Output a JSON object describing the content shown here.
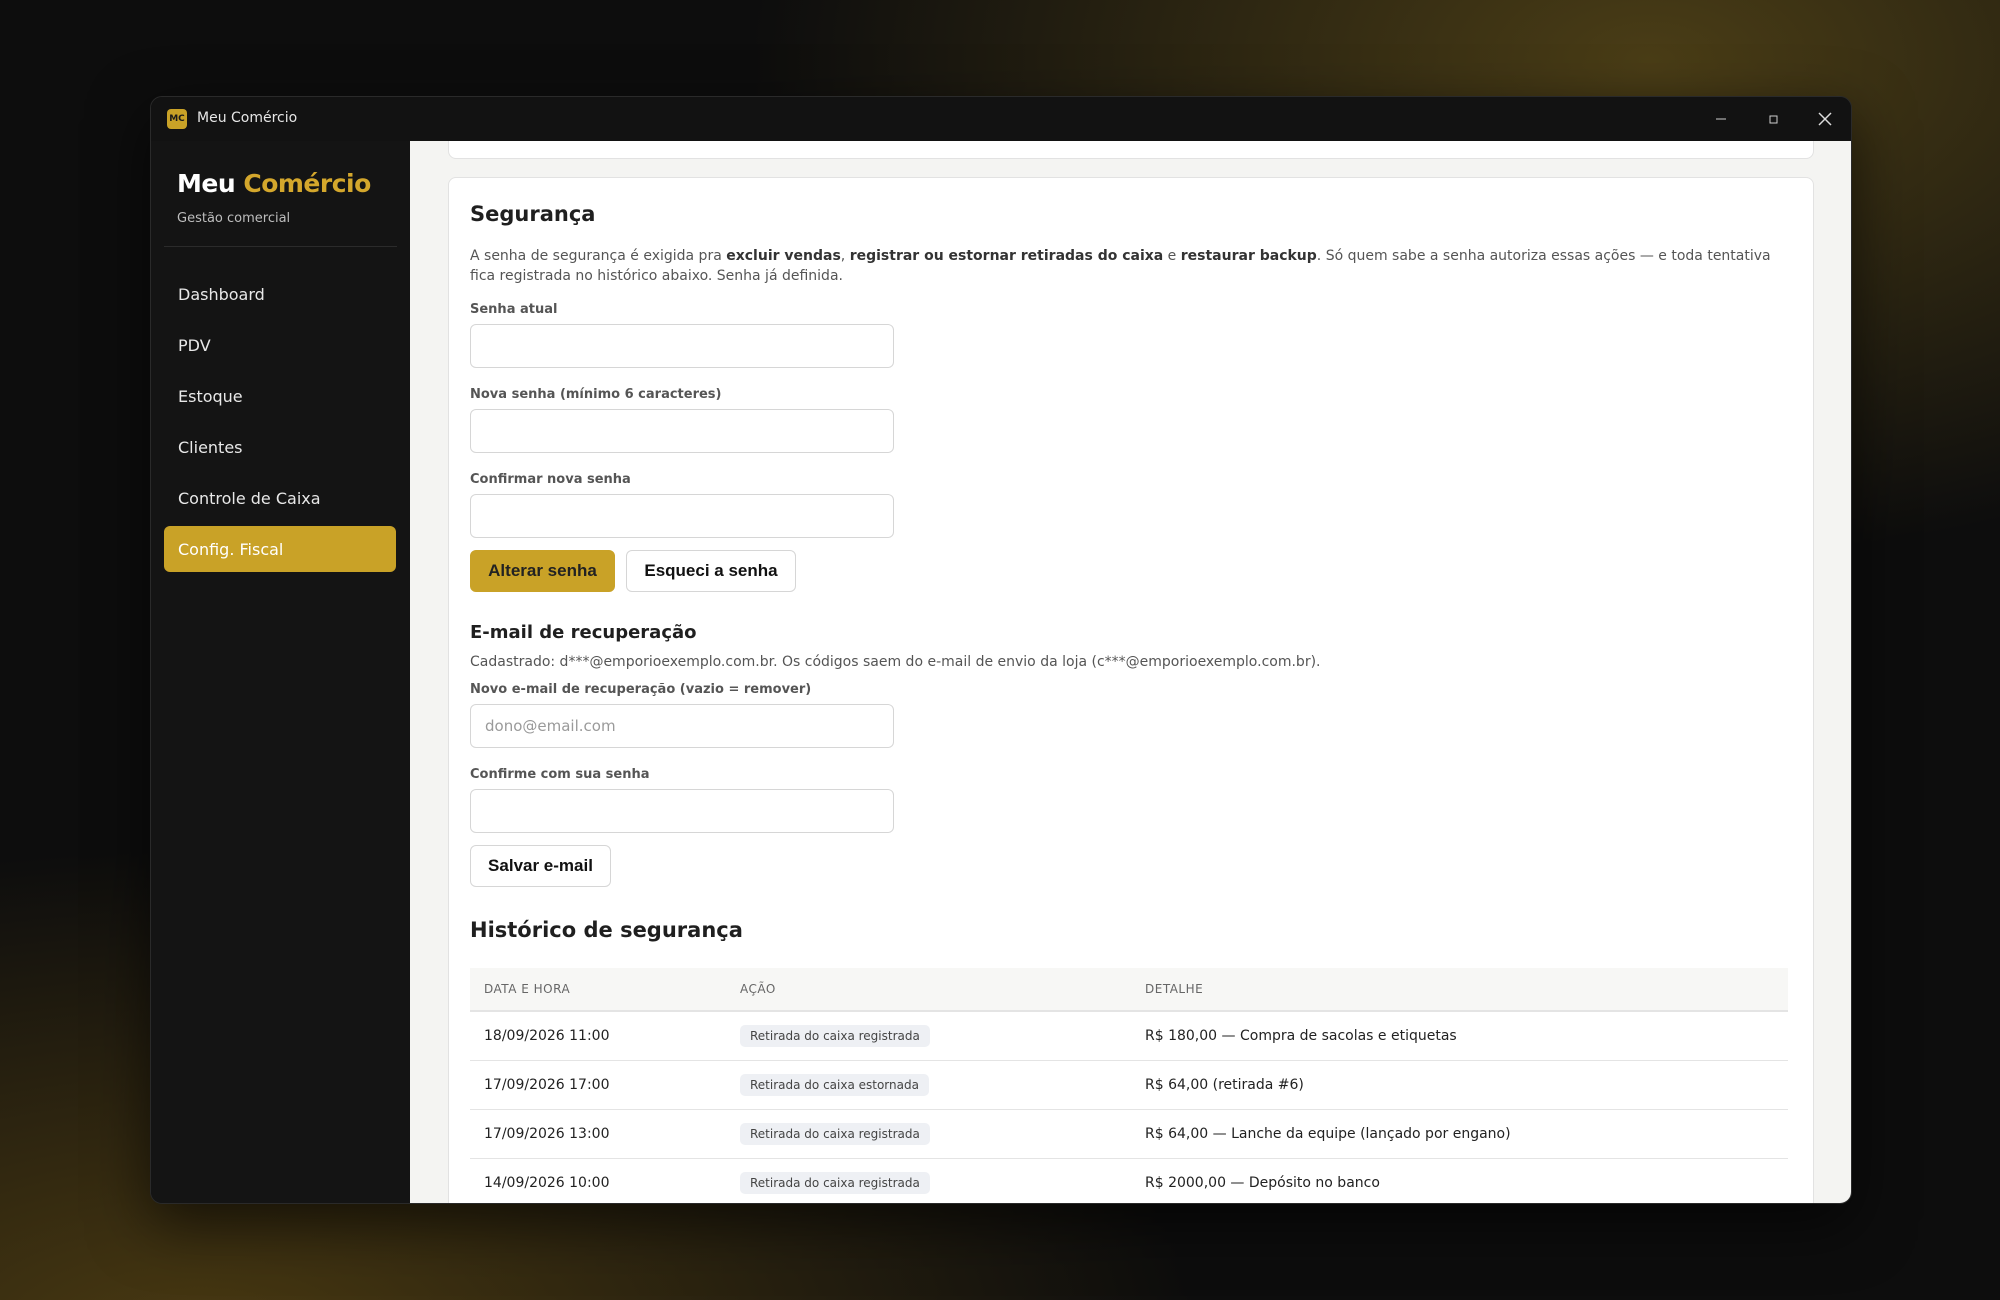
{
  "window": {
    "app_icon_text": "MC",
    "title": "Meu Comércio"
  },
  "sidebar": {
    "brand_part1": "Meu",
    "brand_part2": "Comércio",
    "subtitle": "Gestão comercial",
    "items": [
      {
        "label": "Dashboard",
        "active": false
      },
      {
        "label": "PDV",
        "active": false
      },
      {
        "label": "Estoque",
        "active": false
      },
      {
        "label": "Clientes",
        "active": false
      },
      {
        "label": "Controle de Caixa",
        "active": false
      },
      {
        "label": "Config. Fiscal",
        "active": true
      }
    ]
  },
  "security": {
    "title": "Segurança",
    "description": {
      "t1": "A senha de segurança é exigida pra ",
      "b1": "excluir vendas",
      "t2": ", ",
      "b2": "registrar ou estornar retiradas do caixa",
      "t3": " e ",
      "b3": "restaurar backup",
      "t4": ". Só quem sabe a senha autoriza essas ações — e toda tentativa fica registrada no histórico abaixo. Senha já definida."
    },
    "current_password_label": "Senha atual",
    "current_password_value": "",
    "new_password_label": "Nova senha (mínimo 6 caracteres)",
    "new_password_value": "",
    "confirm_password_label": "Confirmar nova senha",
    "confirm_password_value": "",
    "change_button": "Alterar senha",
    "forgot_button": "Esqueci a senha"
  },
  "recovery": {
    "title": "E-mail de recuperação",
    "registered_text": "Cadastrado: d***@emporioexemplo.com.br. Os códigos saem do e-mail de envio da loja (c***@emporioexemplo.com.br).",
    "new_email_label": "Novo e-mail de recuperação (vazio = remover)",
    "new_email_placeholder": "dono@email.com",
    "new_email_value": "",
    "confirm_label": "Confirme com sua senha",
    "confirm_value": "",
    "save_button": "Salvar e-mail"
  },
  "history": {
    "title": "Histórico de segurança",
    "columns": [
      "DATA E HORA",
      "AÇÃO",
      "DETALHE"
    ],
    "rows": [
      {
        "datetime": "18/09/2026 11:00",
        "action": "Retirada do caixa registrada",
        "detail": "R$ 180,00 — Compra de sacolas e etiquetas"
      },
      {
        "datetime": "17/09/2026 17:00",
        "action": "Retirada do caixa estornada",
        "detail": "R$ 64,00 (retirada #6)"
      },
      {
        "datetime": "17/09/2026 13:00",
        "action": "Retirada do caixa registrada",
        "detail": "R$ 64,00 — Lanche da equipe (lançado por engano)"
      },
      {
        "datetime": "14/09/2026 10:00",
        "action": "Retirada do caixa registrada",
        "detail": "R$ 2000,00 — Depósito no banco"
      }
    ]
  },
  "colors": {
    "accent": "#c9a227",
    "sidebar_bg": "#141414",
    "content_bg": "#f4f4f2"
  }
}
